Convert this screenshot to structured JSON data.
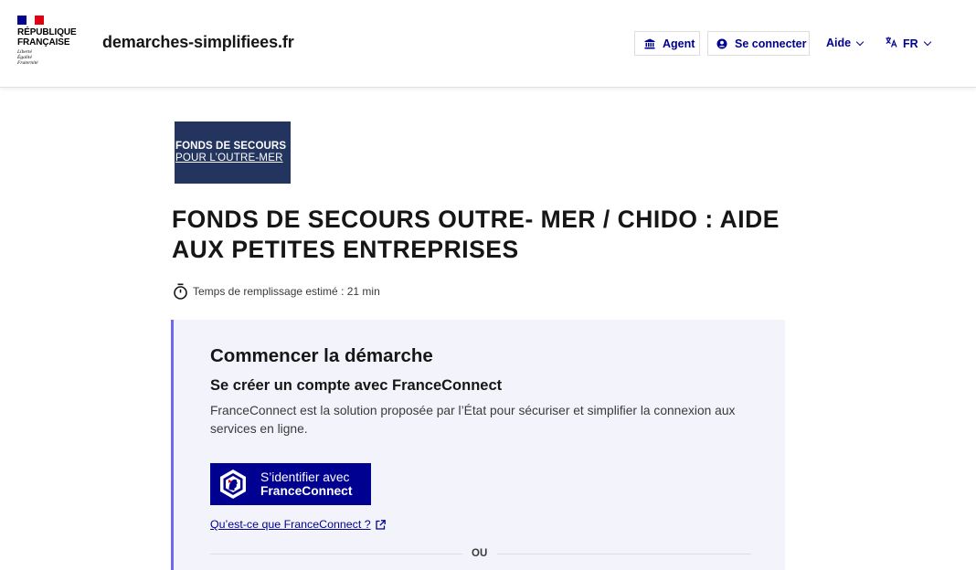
{
  "header": {
    "gov_name_line1": "RÉPUBLIQUE",
    "gov_name_line2": "FRANÇAISE",
    "motto": [
      "Liberté",
      "Égalité",
      "Fraternité"
    ],
    "site_name": "demarches-simplifiees.fr",
    "agent_label": "Agent",
    "login_label": "Se connecter",
    "help_label": "Aide",
    "lang_label": "FR"
  },
  "procedure": {
    "logo_line1": "FONDS DE SECOURS",
    "logo_line2": "POUR L’OUTRE-MER",
    "title": "FONDS DE SECOURS OUTRE- MER / CHIDO : AIDE AUX PETITES ENTREPRISES",
    "estimated_time": "Temps de remplissage estimé : 21 min"
  },
  "start_card": {
    "title": "Commencer la démarche",
    "subtitle": "Se créer un compte avec FranceConnect",
    "description": "FranceConnect est la solution proposée par l’État pour sécuriser et simplifier la connexion aux services en ligne.",
    "fc_button_line1": "S’identifier avec",
    "fc_button_line2": "FranceConnect",
    "fc_help_link": "Qu’est-ce que FranceConnect ?",
    "separator_text": "OU"
  },
  "colors": {
    "primary": "#000091",
    "accent_border": "#6a6af4",
    "card_bg": "#f3f4fb",
    "logo_bg": "#23345e"
  },
  "icons": {
    "agent": "institution-icon",
    "login": "user-circle-icon",
    "lang": "translate-icon",
    "timer": "timer-icon",
    "external": "external-link-icon"
  }
}
